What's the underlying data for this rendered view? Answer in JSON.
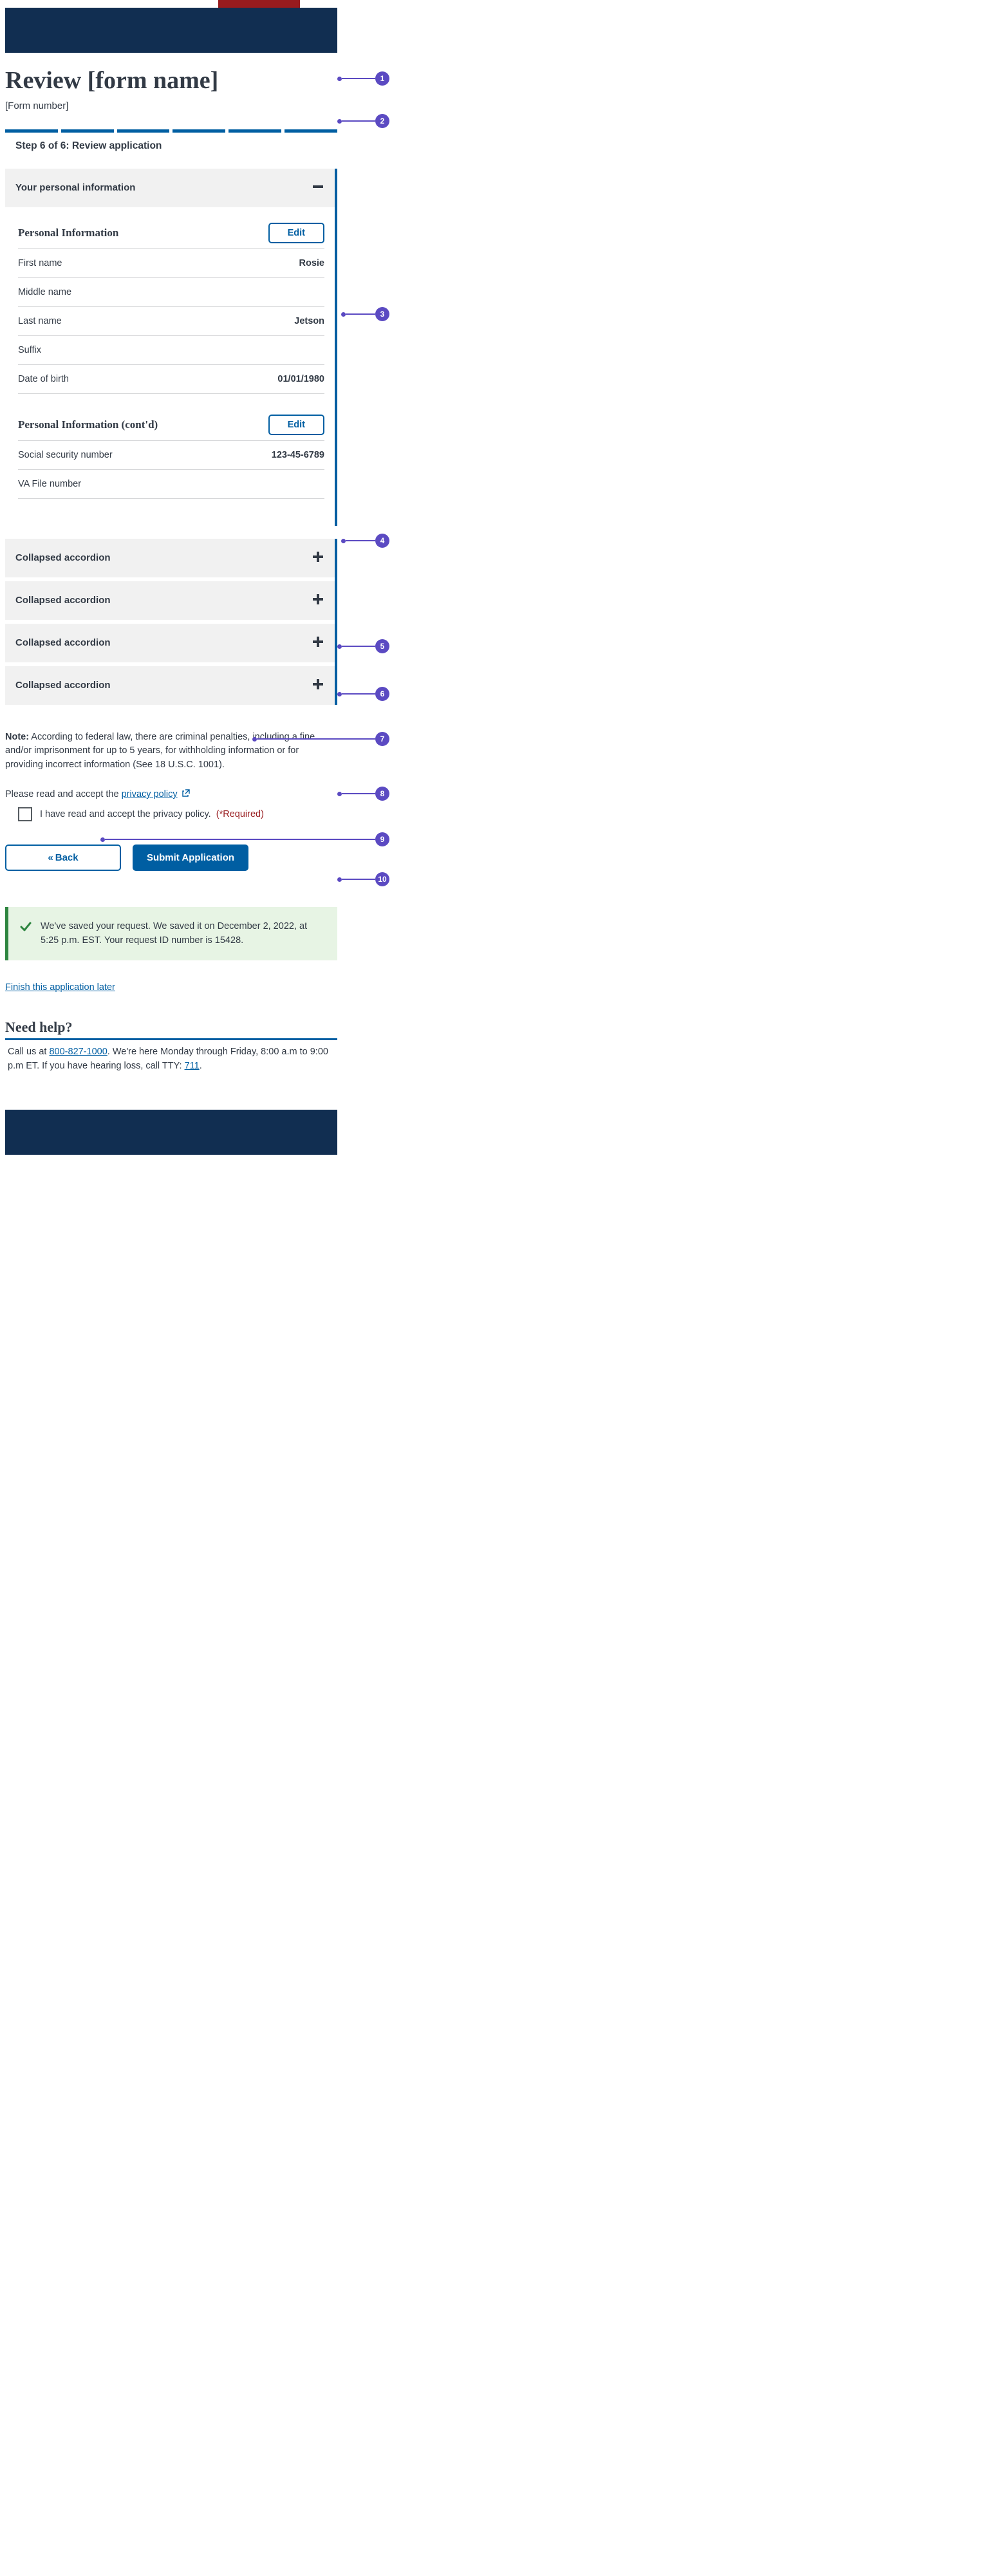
{
  "header": {
    "title": "Review [form name]",
    "form_number": "[Form number]"
  },
  "progress": {
    "step_label": "Step 6 of 6: Review application"
  },
  "review": {
    "header": "Your personal information",
    "sections": [
      {
        "title": "Personal Information",
        "edit_label": "Edit",
        "rows": [
          {
            "label": "First name",
            "value": "Rosie"
          },
          {
            "label": "Middle name",
            "value": ""
          },
          {
            "label": "Last name",
            "value": "Jetson"
          },
          {
            "label": "Suffix",
            "value": ""
          },
          {
            "label": "Date of birth",
            "value": "01/01/1980"
          }
        ]
      },
      {
        "title": "Personal Information (cont'd)",
        "edit_label": "Edit",
        "rows": [
          {
            "label": "Social security number",
            "value": "123-45-6789"
          },
          {
            "label": "VA File number",
            "value": ""
          }
        ]
      }
    ]
  },
  "collapsed": [
    "Collapsed accordion",
    "Collapsed accordion",
    "Collapsed accordion",
    "Collapsed accordion"
  ],
  "note": {
    "prefix": "Note:",
    "body": " According to federal law, there are criminal penalties, including a fine and/or imprisonment for up to 5 years, for withholding information or for providing incorrect information (See 18 U.S.C. 1001)."
  },
  "privacy": {
    "lead": "Please read and accept the ",
    "link_text": "privacy policy",
    "checkbox_label": "I have read and accept the privacy policy.",
    "required": "(*Required)"
  },
  "buttons": {
    "back": "Back",
    "submit": "Submit Application"
  },
  "alert": {
    "text": "We've saved your request. We saved it on December 2, 2022, at 5:25 p.m. EST. Your request ID number is 15428."
  },
  "finish_link": "Finish this application later",
  "help": {
    "title": "Need help?",
    "pre": "Call us at ",
    "phone": "800-827-1000",
    "mid": ". We're here Monday through Friday, 8:00 a.m to 9:00 p.m ET. If you have hearing loss, call TTY: ",
    "tty": "711",
    "post": "."
  },
  "annotations": [
    "1",
    "2",
    "3",
    "4",
    "5",
    "6",
    "7",
    "8",
    "9",
    "10"
  ]
}
